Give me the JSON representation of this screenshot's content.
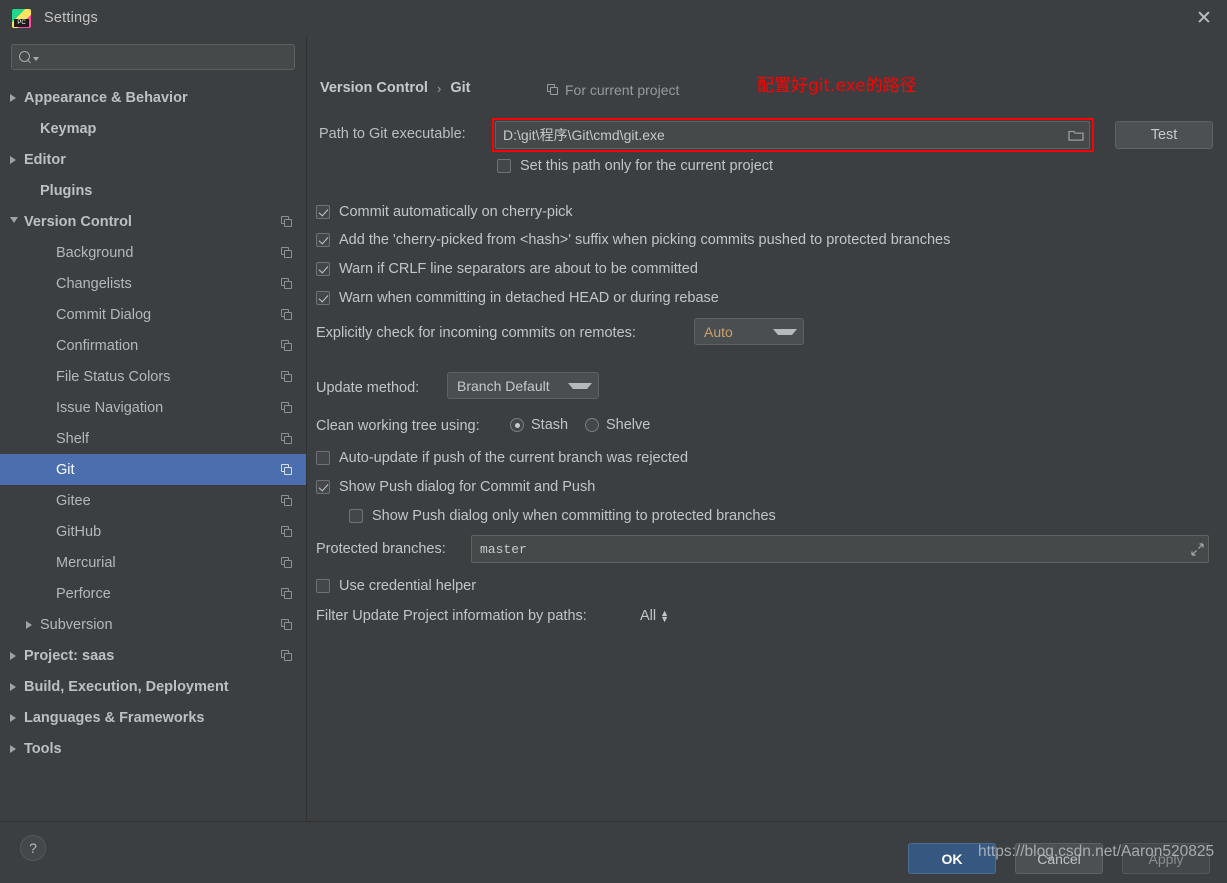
{
  "window": {
    "title": "Settings",
    "app_icon": "pycharm-icon",
    "close_label": "✕"
  },
  "search": {
    "value": "",
    "placeholder": ""
  },
  "sidebar": {
    "items": [
      {
        "label": "Appearance & Behavior",
        "indent": 0,
        "arrow": "right",
        "bold": true,
        "copy": false,
        "selected": false
      },
      {
        "label": "Keymap",
        "indent": 1,
        "arrow": "none",
        "bold": true,
        "copy": false,
        "selected": false
      },
      {
        "label": "Editor",
        "indent": 0,
        "arrow": "right",
        "bold": true,
        "copy": false,
        "selected": false
      },
      {
        "label": "Plugins",
        "indent": 1,
        "arrow": "none",
        "bold": true,
        "copy": false,
        "selected": false
      },
      {
        "label": "Version Control",
        "indent": 0,
        "arrow": "down",
        "bold": true,
        "copy": true,
        "selected": false
      },
      {
        "label": "Background",
        "indent": 2,
        "arrow": "none",
        "bold": false,
        "copy": true,
        "selected": false
      },
      {
        "label": "Changelists",
        "indent": 2,
        "arrow": "none",
        "bold": false,
        "copy": true,
        "selected": false
      },
      {
        "label": "Commit Dialog",
        "indent": 2,
        "arrow": "none",
        "bold": false,
        "copy": true,
        "selected": false
      },
      {
        "label": "Confirmation",
        "indent": 2,
        "arrow": "none",
        "bold": false,
        "copy": true,
        "selected": false
      },
      {
        "label": "File Status Colors",
        "indent": 2,
        "arrow": "none",
        "bold": false,
        "copy": true,
        "selected": false
      },
      {
        "label": "Issue Navigation",
        "indent": 2,
        "arrow": "none",
        "bold": false,
        "copy": true,
        "selected": false
      },
      {
        "label": "Shelf",
        "indent": 2,
        "arrow": "none",
        "bold": false,
        "copy": true,
        "selected": false
      },
      {
        "label": "Git",
        "indent": 2,
        "arrow": "none",
        "bold": false,
        "copy": true,
        "selected": true
      },
      {
        "label": "Gitee",
        "indent": 2,
        "arrow": "none",
        "bold": false,
        "copy": true,
        "selected": false
      },
      {
        "label": "GitHub",
        "indent": 2,
        "arrow": "none",
        "bold": false,
        "copy": true,
        "selected": false
      },
      {
        "label": "Mercurial",
        "indent": 2,
        "arrow": "none",
        "bold": false,
        "copy": true,
        "selected": false
      },
      {
        "label": "Perforce",
        "indent": 2,
        "arrow": "none",
        "bold": false,
        "copy": true,
        "selected": false
      },
      {
        "label": "Subversion",
        "indent": 1,
        "arrow": "right",
        "bold": false,
        "copy": true,
        "selected": false
      },
      {
        "label": "Project: saas",
        "indent": 0,
        "arrow": "right",
        "bold": true,
        "copy": true,
        "selected": false
      },
      {
        "label": "Build, Execution, Deployment",
        "indent": 0,
        "arrow": "right",
        "bold": true,
        "copy": false,
        "selected": false
      },
      {
        "label": "Languages & Frameworks",
        "indent": 0,
        "arrow": "right",
        "bold": true,
        "copy": false,
        "selected": false
      },
      {
        "label": "Tools",
        "indent": 0,
        "arrow": "right",
        "bold": true,
        "copy": false,
        "selected": false
      }
    ]
  },
  "main": {
    "breadcrumb_parent": "Version Control",
    "breadcrumb_sep": "›",
    "breadcrumb_current": "Git",
    "for_current_project": "For current project",
    "annotation_note": "配置好git.exe的路径",
    "path_label": "Path to Git executable:",
    "path_value": "D:\\git\\程序\\Git\\cmd\\git.exe",
    "test_button": "Test",
    "set_path_only_label": "Set this path only for the current project",
    "set_path_only_checked": false,
    "checkboxes": [
      {
        "label": "Commit automatically on cherry-pick",
        "checked": true
      },
      {
        "label": "Add the 'cherry-picked from <hash>' suffix when picking commits pushed to protected branches",
        "checked": true
      },
      {
        "label": "Warn if CRLF line separators are about to be committed",
        "checked": true
      },
      {
        "label": "Warn when committing in detached HEAD or during rebase",
        "checked": true
      }
    ],
    "incoming_label": "Explicitly check for incoming commits on remotes:",
    "incoming_value": "Auto",
    "update_method_label": "Update method:",
    "update_method_value": "Branch Default",
    "clean_tree_label": "Clean working tree using:",
    "clean_tree_options": [
      {
        "label": "Stash",
        "selected": true
      },
      {
        "label": "Shelve",
        "selected": false
      }
    ],
    "auto_update_label": "Auto-update if push of the current branch was rejected",
    "auto_update_checked": false,
    "show_push_label": "Show Push dialog for Commit and Push",
    "show_push_checked": true,
    "show_push_protected_label": "Show Push dialog only when committing to protected branches",
    "show_push_protected_checked": false,
    "protected_branches_label": "Protected branches:",
    "protected_branches_value": "master",
    "credential_helper_label": "Use credential helper",
    "credential_helper_checked": false,
    "filter_label": "Filter Update Project information by paths:",
    "filter_value": "All"
  },
  "footer": {
    "help_label": "?",
    "ok_label": "OK",
    "cancel_label": "Cancel",
    "apply_label": "Apply"
  },
  "watermark": "https://blog.csdn.net/Aaron520825",
  "colors": {
    "background": "#3c3f41",
    "selection": "#4b6eaf",
    "accent_button": "#365880",
    "annotation_red": "#ff0000",
    "combo_value": "#c8a06a"
  }
}
